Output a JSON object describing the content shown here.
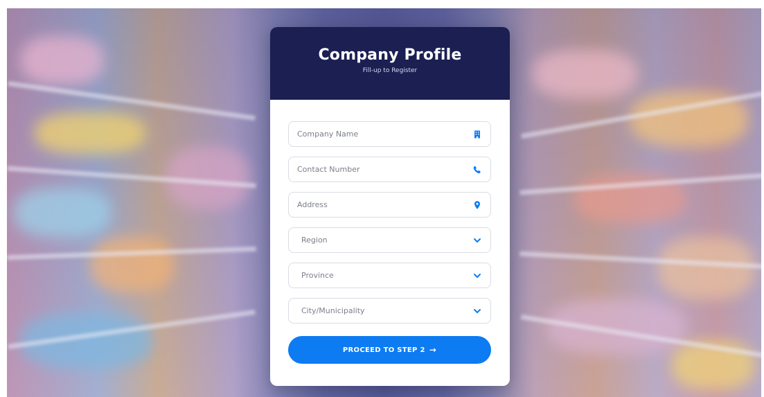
{
  "card": {
    "title": "Company Profile",
    "subtitle": "Fill-up to Register"
  },
  "form": {
    "company_name": {
      "placeholder": "Company Name",
      "icon": "building-icon"
    },
    "contact_number": {
      "placeholder": "Contact Number",
      "icon": "phone-icon"
    },
    "address": {
      "placeholder": "Address",
      "icon": "map-pin-icon"
    },
    "region": {
      "selected": "Region",
      "icon": "chevron-down-icon"
    },
    "province": {
      "selected": "Province",
      "icon": "chevron-down-icon"
    },
    "city": {
      "selected": "City/Municipality",
      "icon": "chevron-down-icon"
    },
    "submit_label": "PROCEED TO STEP 2",
    "submit_arrow": "→"
  },
  "colors": {
    "header": "#1b1f52",
    "accent": "#0d7bf2",
    "field_border": "#d9dce3"
  }
}
